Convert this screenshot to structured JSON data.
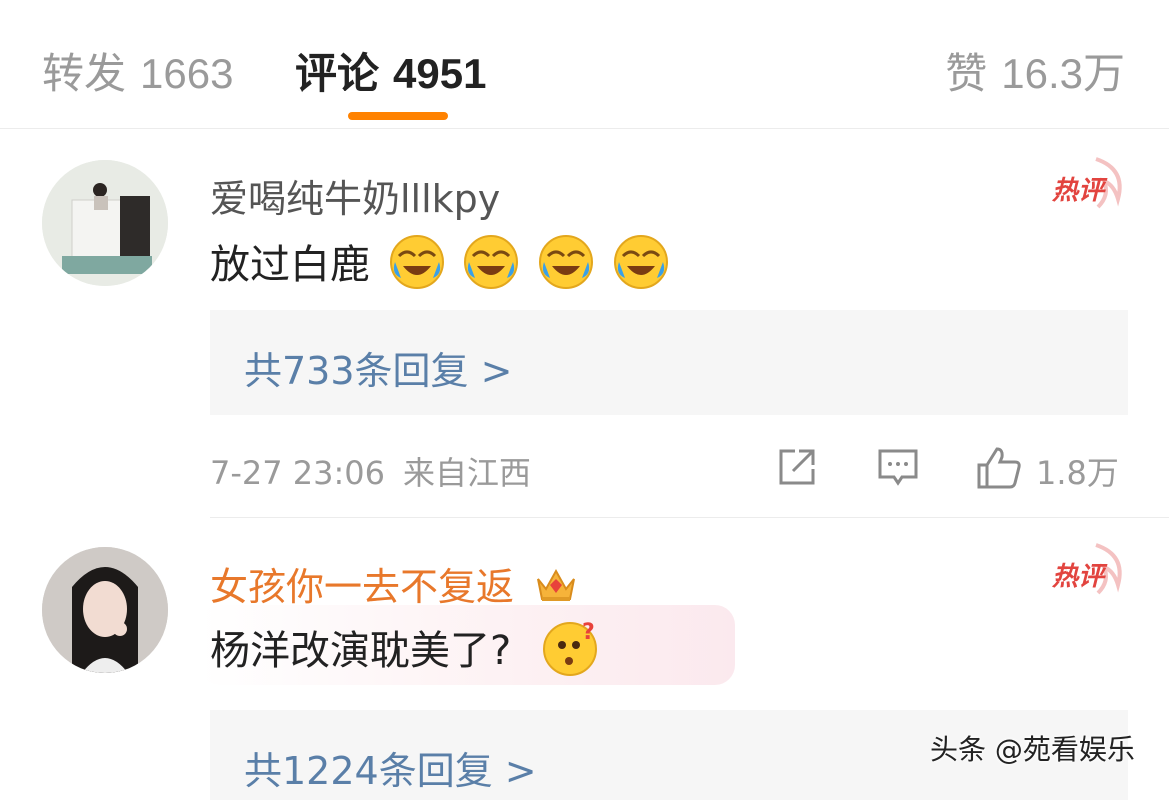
{
  "tabs": {
    "forward_label": "转发",
    "forward_count": "1663",
    "comments_label": "评论",
    "comments_count": "4951",
    "likes_label": "赞",
    "likes_count": "16.3万",
    "active": "评论",
    "accent_color": "#ff8200"
  },
  "comments": [
    {
      "username": "爱喝纯牛奶lllkpy",
      "text": "放过白鹿",
      "emojis": [
        "laugh-cry-icon",
        "laugh-cry-icon",
        "laugh-cry-icon",
        "laugh-cry-icon"
      ],
      "badge": "热评",
      "replies_label": "共733条回复 >",
      "time": "7-27 23:06",
      "location": "来自江西",
      "like_count": "1.8万"
    },
    {
      "username": "女孩你一去不复返",
      "username_icon": "crown-icon",
      "text": "杨洋改演耽美了?",
      "emojis": [
        "confused-face-icon"
      ],
      "badge": "热评",
      "replies_label": "共1224条回复 >"
    }
  ],
  "watermark": "头条 @苑看娱乐"
}
